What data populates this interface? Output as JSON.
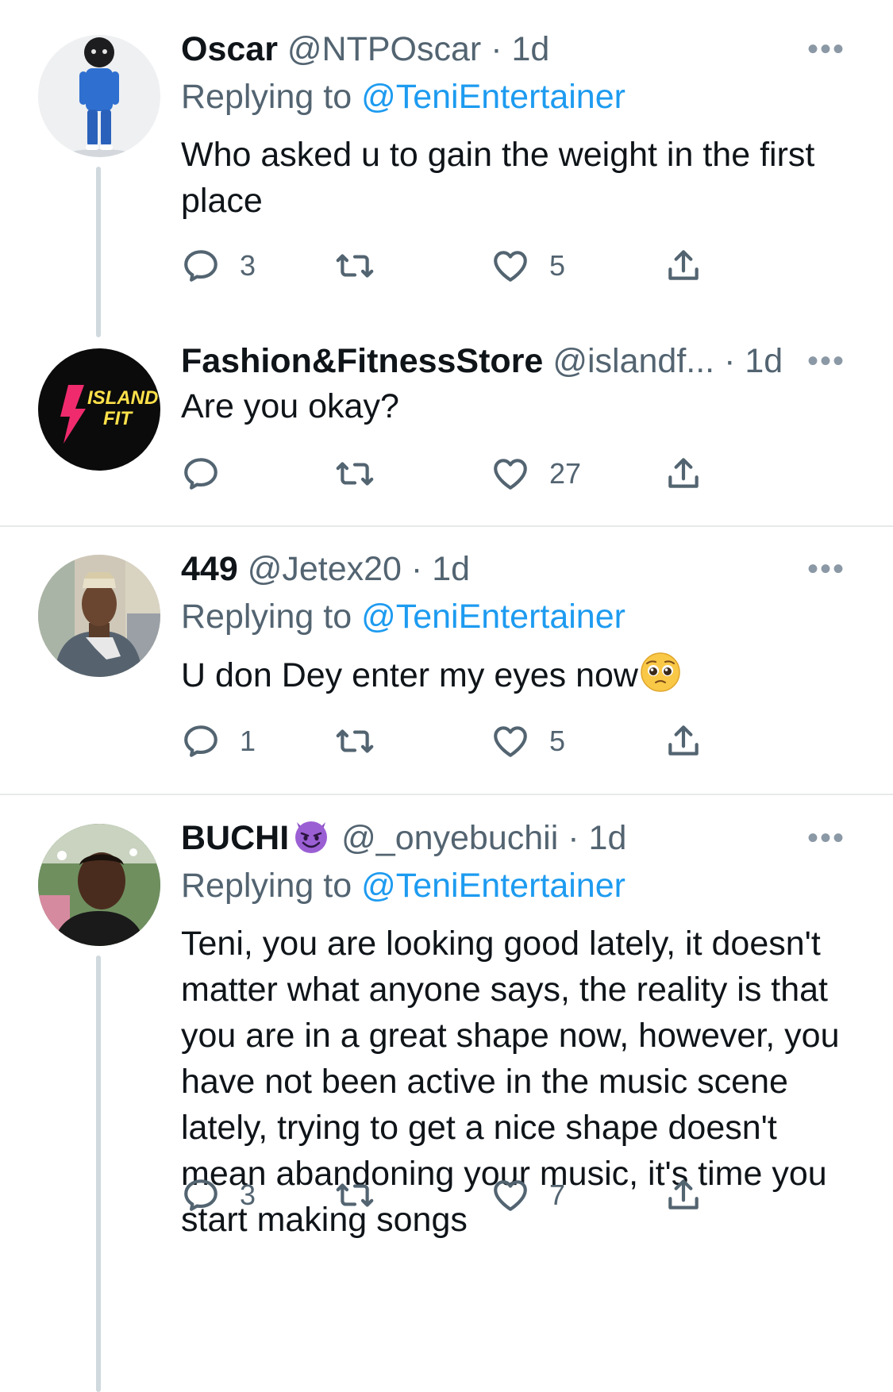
{
  "tweets": [
    {
      "name": "Oscar",
      "handle": "@NTPOscar",
      "dot": "·",
      "time": "1d",
      "replying_prefix": "Replying to ",
      "replying_to": "@TeniEntertainer",
      "text": "Who asked u to gain the weight in the first place",
      "replies": "3",
      "retweets": "",
      "likes": "5",
      "more": "•••"
    },
    {
      "name": "Fashion&FitnessStore",
      "handle": "@islandf...",
      "dot": "·",
      "time": "1d",
      "avatar_text_1": "ISLAND",
      "avatar_text_2": "FIT",
      "text": "Are you okay?",
      "replies": "",
      "retweets": "",
      "likes": "27",
      "more": "•••"
    },
    {
      "name": "449",
      "handle": "@Jetex20",
      "dot": "·",
      "time": "1d",
      "replying_prefix": "Replying to ",
      "replying_to": "@TeniEntertainer",
      "text": "U don Dey enter my eyes now",
      "replies": "1",
      "retweets": "",
      "likes": "5",
      "more": "•••"
    },
    {
      "name": "BUCHI",
      "handle": "@_onyebuchii",
      "dot": "·",
      "time": "1d",
      "replying_prefix": "Replying to ",
      "replying_to": "@TeniEntertainer",
      "text": "Teni, you are looking good lately, it doesn't matter what anyone says, the reality is that you are in a great shape now, however, you have not been active in the music scene lately, trying to get a nice shape doesn't mean abandoning your music, it's time you start making songs",
      "replies": "3",
      "retweets": "",
      "likes": "7",
      "more": "•••"
    }
  ],
  "colors": {
    "link": "#1d9bf0",
    "muted": "#536471",
    "divider": "#e7e9ea",
    "thread": "#cfd9de"
  }
}
